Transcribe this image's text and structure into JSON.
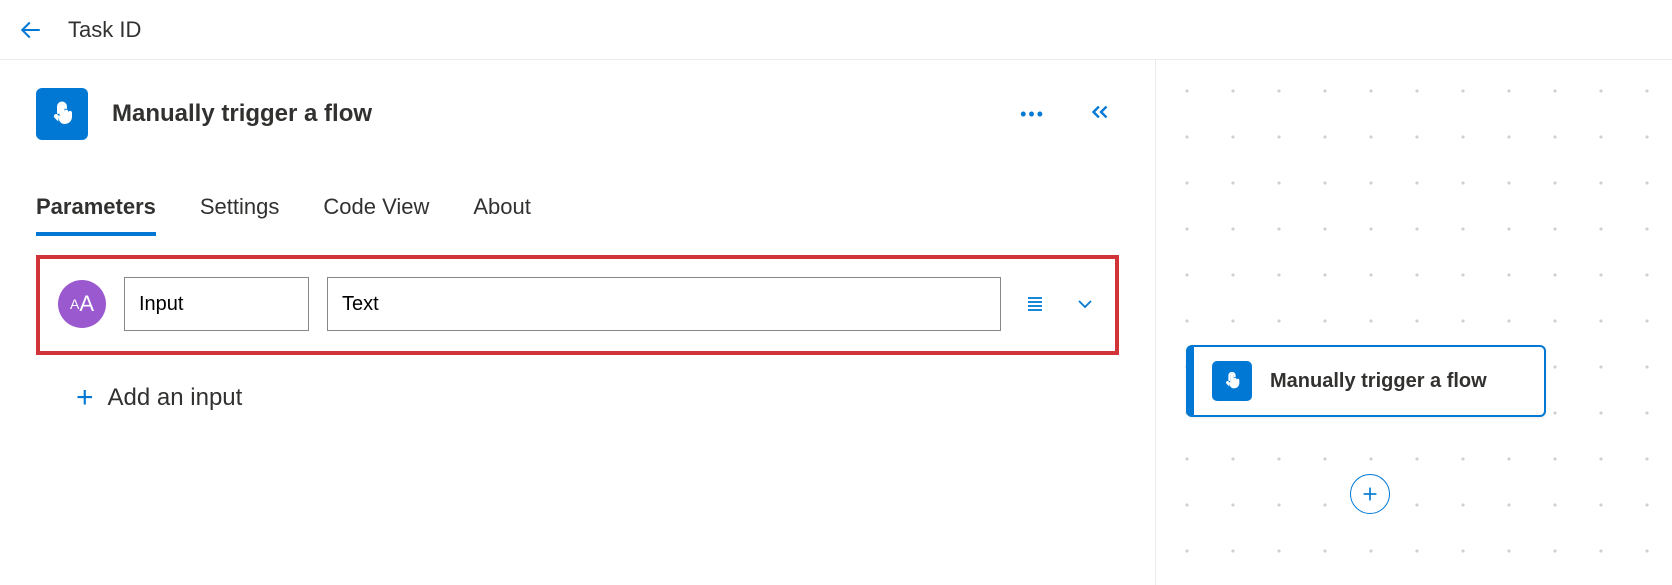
{
  "header": {
    "title": "Task ID"
  },
  "trigger": {
    "title": "Manually trigger a flow"
  },
  "tabs": {
    "parameters": "Parameters",
    "settings": "Settings",
    "codeview": "Code View",
    "about": "About",
    "active": "parameters"
  },
  "input_row": {
    "type_badge": "AA",
    "name_value": "Input",
    "value_value": "Text"
  },
  "add_input_label": "Add an input",
  "canvas": {
    "card_title": "Manually trigger a flow"
  }
}
